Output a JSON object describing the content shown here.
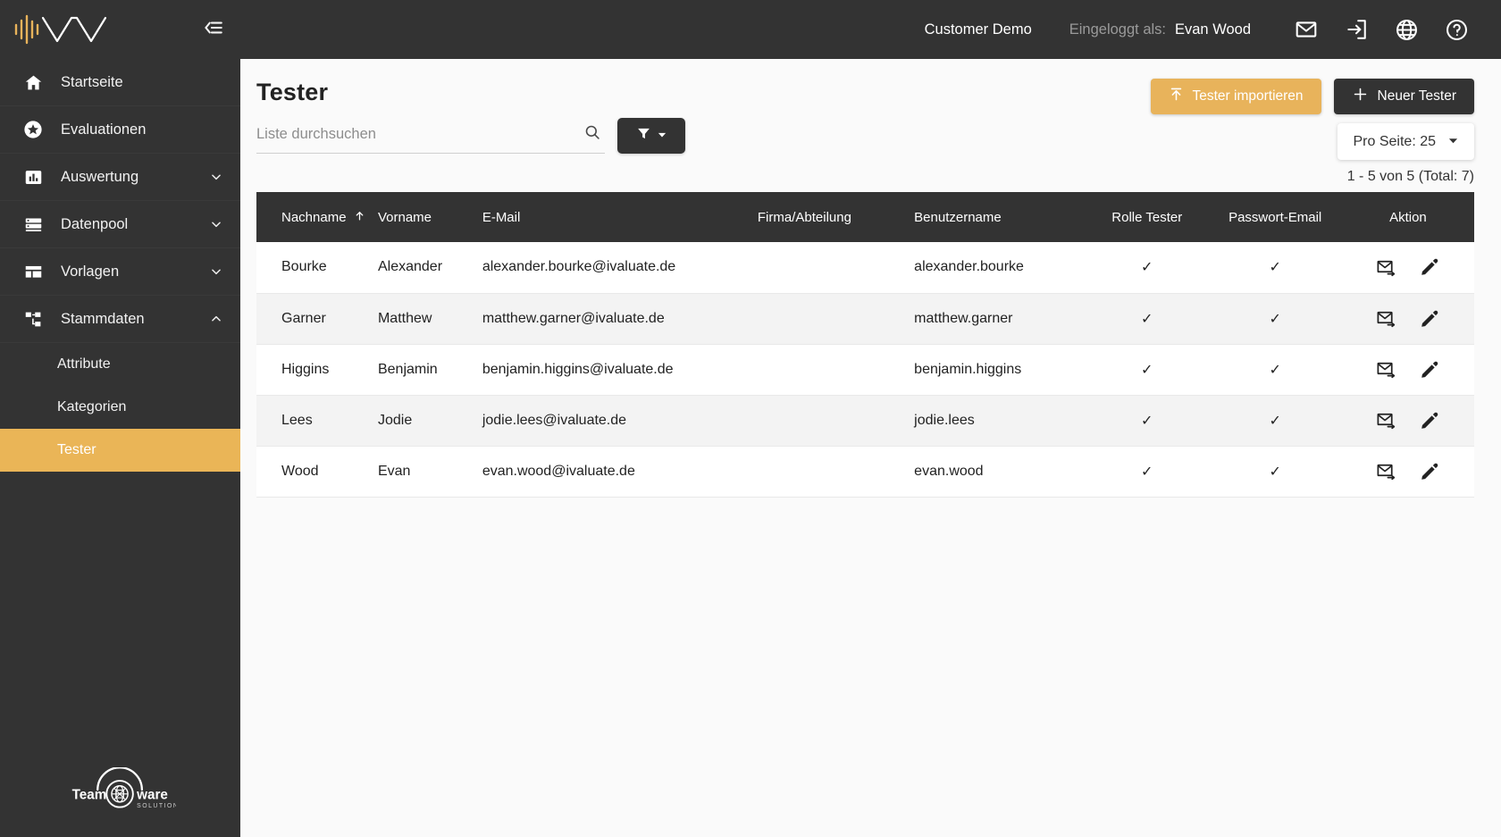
{
  "sidebar": {
    "brand_logo_name": "ivaluate-waveform-logo",
    "collapse_icon": "collapse-menu-icon",
    "accent_color": "#eab557",
    "items": [
      {
        "label": "Startseite",
        "icon": "home-icon",
        "expandable": false,
        "expanded": false
      },
      {
        "label": "Evaluationen",
        "icon": "star-badge-icon",
        "expandable": false,
        "expanded": false
      },
      {
        "label": "Auswertung",
        "icon": "bar-chart-icon",
        "expandable": true,
        "expanded": false
      },
      {
        "label": "Datenpool",
        "icon": "database-list-icon",
        "expandable": true,
        "expanded": false
      },
      {
        "label": "Vorlagen",
        "icon": "layout-template-icon",
        "expandable": true,
        "expanded": false
      },
      {
        "label": "Stammdaten",
        "icon": "sitemap-icon",
        "expandable": true,
        "expanded": true
      }
    ],
    "subitems": [
      {
        "label": "Attribute",
        "active": false
      },
      {
        "label": "Kategorien",
        "active": false
      },
      {
        "label": "Tester",
        "active": true
      }
    ],
    "footer_logo": {
      "text_left": "Team",
      "text_right": "ware",
      "subtitle": "SOLUTIONS",
      "icon": "globe-network-icon"
    }
  },
  "topbar": {
    "customer": "Customer Demo",
    "logged_in_label": "Eingeloggt als:",
    "user_name": "Evan Wood",
    "icons": [
      {
        "name": "mail-icon"
      },
      {
        "name": "logout-icon"
      },
      {
        "name": "globe-language-icon"
      },
      {
        "name": "help-circle-icon"
      }
    ]
  },
  "page": {
    "title": "Tester",
    "import_button": "Tester importieren",
    "import_icon": "upload-icon",
    "new_button": "Neuer Tester",
    "new_icon": "plus-icon",
    "search_placeholder": "Liste durchsuchen",
    "search_value": "",
    "search_icon": "search-icon",
    "filter_icon": "filter-funnel-icon",
    "filter_caret": "caret-down-icon",
    "per_page_label": "Pro Seite: 25",
    "per_page_caret": "caret-down-icon",
    "result_count": "1 - 5 von 5 (Total: 7)"
  },
  "table": {
    "columns": [
      {
        "label": "Nachname",
        "sorted": true,
        "sort_icon": "arrow-up-icon",
        "align": "left"
      },
      {
        "label": "Vorname",
        "sorted": false,
        "align": "left"
      },
      {
        "label": "E-Mail",
        "sorted": false,
        "align": "left"
      },
      {
        "label": "Firma/Abteilung",
        "sorted": false,
        "align": "left"
      },
      {
        "label": "Benutzername",
        "sorted": false,
        "align": "left"
      },
      {
        "label": "Rolle Tester",
        "sorted": false,
        "align": "center"
      },
      {
        "label": "Passwort-Email",
        "sorted": false,
        "align": "center"
      },
      {
        "label": "Aktion",
        "sorted": false,
        "align": "center"
      }
    ],
    "rows": [
      {
        "nachname": "Bourke",
        "vorname": "Alexander",
        "email": "alexander.bourke@ivaluate.de",
        "firma": "",
        "benutzername": "alexander.bourke",
        "rolle_tester": "✓",
        "passwort_email": "✓"
      },
      {
        "nachname": "Garner",
        "vorname": "Matthew",
        "email": "matthew.garner@ivaluate.de",
        "firma": "",
        "benutzername": "matthew.garner",
        "rolle_tester": "✓",
        "passwort_email": "✓"
      },
      {
        "nachname": "Higgins",
        "vorname": "Benjamin",
        "email": "benjamin.higgins@ivaluate.de",
        "firma": "",
        "benutzername": "benjamin.higgins",
        "rolle_tester": "✓",
        "passwort_email": "✓"
      },
      {
        "nachname": "Lees",
        "vorname": "Jodie",
        "email": "jodie.lees@ivaluate.de",
        "firma": "",
        "benutzername": "jodie.lees",
        "rolle_tester": "✓",
        "passwort_email": "✓"
      },
      {
        "nachname": "Wood",
        "vorname": "Evan",
        "email": "evan.wood@ivaluate.de",
        "firma": "",
        "benutzername": "evan.wood",
        "rolle_tester": "✓",
        "passwort_email": "✓"
      }
    ],
    "action_icons": [
      {
        "name": "send-email-icon"
      },
      {
        "name": "edit-pencil-icon"
      }
    ]
  }
}
